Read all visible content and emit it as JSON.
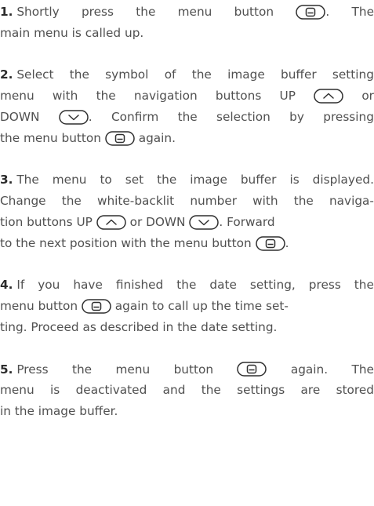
{
  "icons": {
    "menu": "menu-button-icon",
    "up": "up-button-icon",
    "down": "down-button-icon"
  },
  "colors": {
    "text": "#505050",
    "icon_stroke": "#2f2f2f"
  },
  "steps": [
    {
      "number": "1.",
      "lines": [
        [
          " Shortly",
          "press",
          "the",
          "menu",
          "button",
          "{menu}",
          ".",
          "The"
        ],
        [
          "main menu is called up."
        ]
      ]
    },
    {
      "number": "2.",
      "lines": [
        [
          " Select",
          "the",
          "symbol",
          "of",
          "the",
          "image",
          "buffer",
          "setting"
        ],
        [
          "menu",
          "with",
          "the",
          "navigation",
          "buttons",
          "UP",
          "{up}",
          "or"
        ],
        [
          "DOWN",
          "{down}",
          ".",
          "Confirm",
          "the",
          "selection",
          "by",
          "pressing"
        ],
        [
          "the menu button ",
          "{menu}",
          " again."
        ]
      ]
    },
    {
      "number": "3.",
      "lines": [
        [
          " The",
          "menu",
          "to",
          "set",
          "the",
          "image",
          "buffer",
          "is",
          "displayed."
        ],
        [
          "Change",
          "the",
          "white-backlit",
          "number",
          "with",
          "the",
          "naviga-"
        ],
        [
          "tion buttons UP ",
          "{up}",
          " or DOWN ",
          "{down}",
          ". Forward"
        ],
        [
          "to the next position with the menu button ",
          "{menu}",
          "."
        ]
      ]
    },
    {
      "number": "4.",
      "lines": [
        [
          " If",
          "you",
          "have",
          "finished",
          "the",
          "date",
          "setting,",
          "press",
          "the"
        ],
        [
          "menu button ",
          "{menu}",
          " again to call up the time set-"
        ],
        [
          "ting. Proceed as described in the date setting."
        ]
      ]
    },
    {
      "number": "5.",
      "lines": [
        [
          " Press",
          "the",
          "menu",
          "button",
          "{menu}",
          "again.",
          "The"
        ],
        [
          "menu",
          "is",
          "deactivated",
          "and",
          "the",
          "settings",
          "are",
          "stored"
        ],
        [
          "in the image buffer."
        ]
      ]
    }
  ]
}
